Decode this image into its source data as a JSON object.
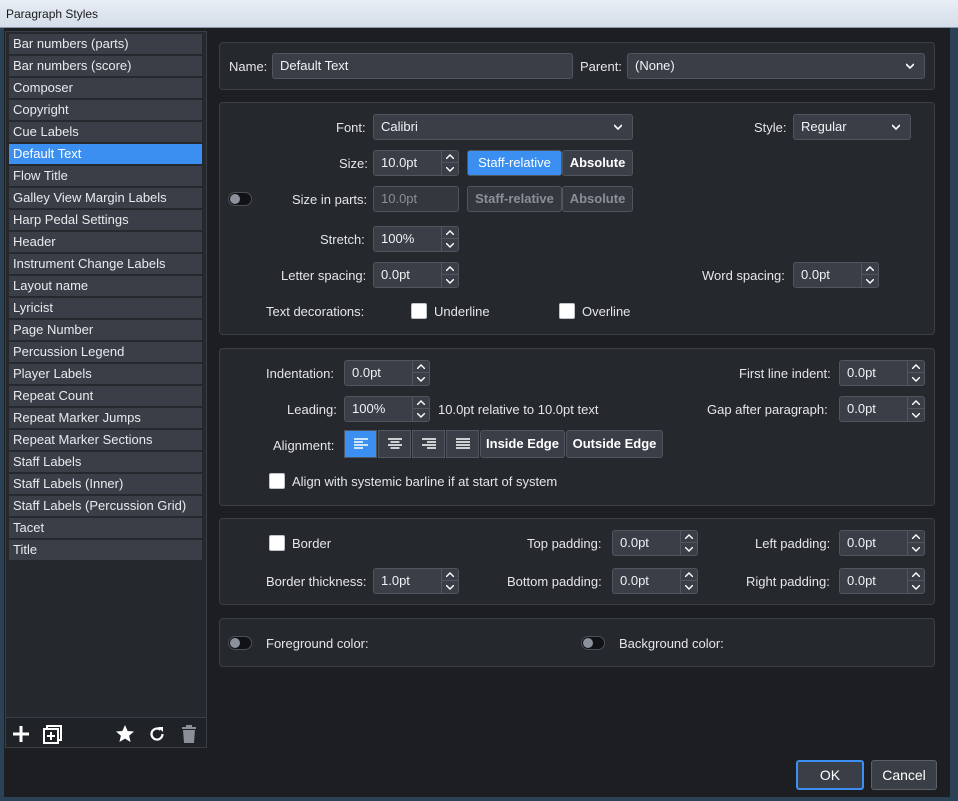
{
  "window": {
    "title": "Paragraph Styles"
  },
  "sidebar": {
    "items": [
      "Bar numbers (parts)",
      "Bar numbers (score)",
      "Composer",
      "Copyright",
      "Cue Labels",
      "Default Text",
      "Flow Title",
      "Galley View Margin Labels",
      "Harp Pedal Settings",
      "Header",
      "Instrument Change Labels",
      "Layout name",
      "Lyricist",
      "Page Number",
      "Percussion Legend",
      "Player Labels",
      "Repeat Count",
      "Repeat Marker Jumps",
      "Repeat Marker Sections",
      "Staff Labels",
      "Staff Labels (Inner)",
      "Staff Labels (Percussion Grid)",
      "Tacet",
      "Title"
    ],
    "selected_index": 5,
    "tools": [
      "add-icon",
      "duplicate-icon",
      "star-icon",
      "reset-icon",
      "trash-icon"
    ]
  },
  "name_row": {
    "name_label": "Name:",
    "name_value": "Default Text",
    "parent_label": "Parent:",
    "parent_value": "(None)"
  },
  "font": {
    "font_label": "Font:",
    "font_value": "Calibri",
    "style_label": "Style:",
    "style_value": "Regular",
    "size_label": "Size:",
    "size_value": "10.0pt",
    "staff_relative": "Staff-relative",
    "absolute": "Absolute",
    "size_parts_label": "Size in parts:",
    "size_parts_value": "10.0pt",
    "stretch_label": "Stretch:",
    "stretch_value": "100%",
    "letter_spacing_label": "Letter spacing:",
    "letter_spacing_value": "0.0pt",
    "word_spacing_label": "Word spacing:",
    "word_spacing_value": "0.0pt",
    "decorations_label": "Text decorations:",
    "underline": "Underline",
    "overline": "Overline"
  },
  "paragraph": {
    "indent_label": "Indentation:",
    "indent_value": "0.0pt",
    "first_line_label": "First line indent:",
    "first_line_value": "0.0pt",
    "leading_label": "Leading:",
    "leading_value": "100%",
    "leading_note": "10.0pt relative to 10.0pt text",
    "gap_label": "Gap after paragraph:",
    "gap_value": "0.0pt",
    "alignment_label": "Alignment:",
    "inside_edge": "Inside Edge",
    "outside_edge": "Outside Edge",
    "align_barline": "Align with systemic barline if at start of system"
  },
  "border": {
    "border_label": "Border",
    "top_padding_label": "Top padding:",
    "top_padding_value": "0.0pt",
    "left_padding_label": "Left padding:",
    "left_padding_value": "0.0pt",
    "thickness_label": "Border thickness:",
    "thickness_value": "1.0pt",
    "bottom_padding_label": "Bottom padding:",
    "bottom_padding_value": "0.0pt",
    "right_padding_label": "Right padding:",
    "right_padding_value": "0.0pt"
  },
  "colors": {
    "foreground_label": "Foreground color:",
    "background_label": "Background color:"
  },
  "buttons": {
    "ok": "OK",
    "cancel": "Cancel"
  },
  "theme": {
    "accent": "#3a8ff0",
    "panel": "#25282d",
    "field": "#3a3f47"
  }
}
